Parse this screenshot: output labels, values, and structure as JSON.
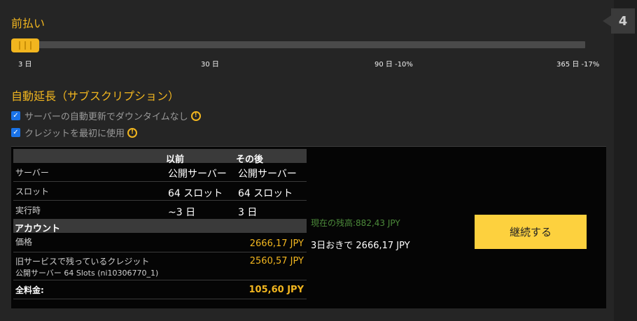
{
  "step": {
    "number": "4"
  },
  "prepay": {
    "title": "前払い",
    "slider": {
      "selected": "3 日",
      "ticks": [
        "3 日",
        "30 日",
        "90 日 -10%",
        "365 日 -17%"
      ]
    }
  },
  "auto_renew": {
    "title": "自動延長（サブスクリプション）",
    "options": [
      {
        "label": "サーバーの自動更新でダウンタイムなし",
        "checked": true
      },
      {
        "label": "クレジットを最初に使用",
        "checked": true
      }
    ]
  },
  "table": {
    "col_before": "以前",
    "col_after": "その後",
    "rows": [
      {
        "label": "サーバー",
        "before": "公開サーバー",
        "after": "公開サーバー"
      },
      {
        "label": "スロット",
        "before": "64 スロット",
        "after": "64 スロット"
      },
      {
        "label": "実行時",
        "before": "~3 日",
        "after": "3 日"
      }
    ],
    "account": {
      "title": "アカウント",
      "price_label": "価格",
      "price_value": "2666,17 JPY",
      "credit_label": "旧サービスで残っているクレジット",
      "credit_sub": "公開サーバー 64 Slots (ni10306770_1)",
      "credit_value": "2560,57 JPY",
      "total_label": "全料金:",
      "total_value": "105,60 JPY"
    }
  },
  "balance": "現在の残高:882,43 JPY",
  "recurring": "3日おきで 2666,17 JPY",
  "continue_label": "継続する",
  "colors": {
    "accent": "#f2b61f",
    "button": "#fdd13e",
    "balance": "#4c8a3a",
    "checkbox": "#1a73e8"
  }
}
